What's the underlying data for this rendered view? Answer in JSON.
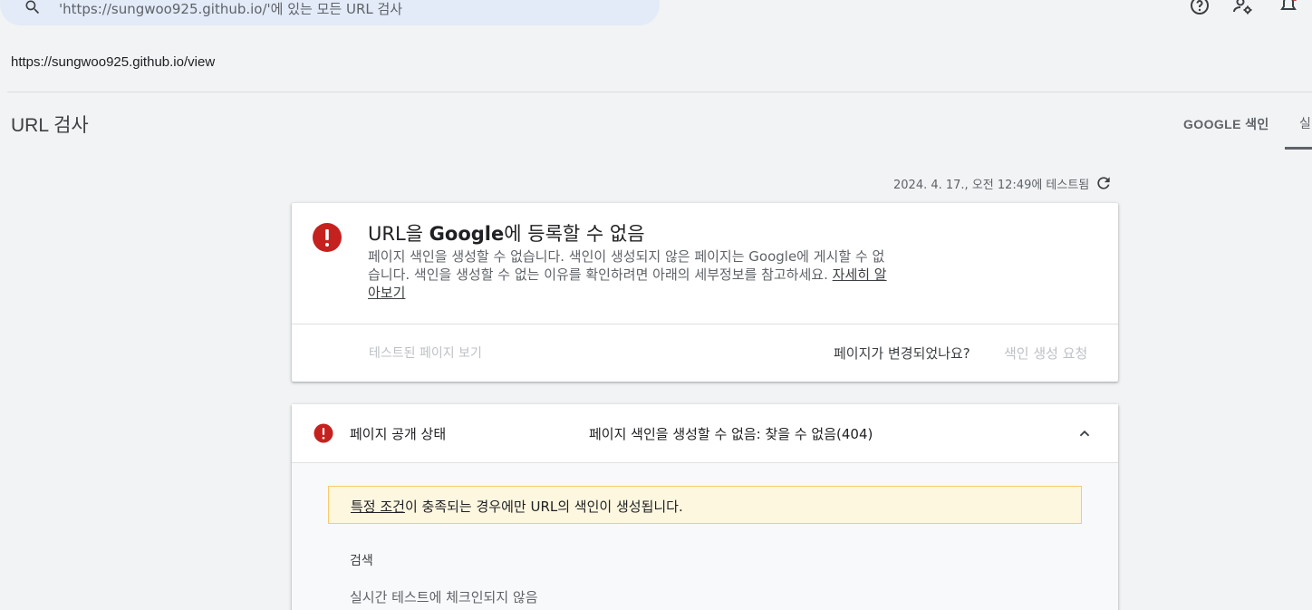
{
  "search": {
    "placeholder": "'https://sungwoo925.github.io/'에 있는 모든 URL 검사",
    "icon": "search-icon"
  },
  "topbar": {
    "icons": [
      "help-icon",
      "admin-settings-icon",
      "notifications-icon"
    ],
    "badge_color": "#d93025"
  },
  "url": "https://sungwoo925.github.io/view",
  "page_title": "URL 검사",
  "tabs": [
    {
      "label": "GOOGLE 색인"
    },
    {
      "label": "실"
    }
  ],
  "tested_at": "2024. 4. 17., 오전 12:49에 테스트됨",
  "result_card": {
    "headline_pre": "URL을 ",
    "headline_brand": "Google",
    "headline_post": "에 등록할 수 없음",
    "description": "페이지 색인을 생성할 수 없습니다. 색인이 생성되지 않은 페이지는 Google에 게시할 수 없습니다. 색인을 생성할 수 없는 이유를 확인하려면 아래의 세부정보를 참고하세요.",
    "learn_more": "자세히 알아보기",
    "view_tested_page": "테스트된 페이지 보기",
    "page_changed_question": "페이지가 변경되었나요?",
    "request_indexing": "색인 생성 요청",
    "error_color": "#c5221f"
  },
  "status_card": {
    "label": "페이지 공개 상태",
    "value": "페이지 색인을 생성할 수 없음: 찾을 수 없음(404)",
    "notice_link": "특정 조건",
    "notice_text": "이 충족되는 경우에만 URL의 색인이 생성됩니다.",
    "section_label": "검색",
    "live_check": "실시간 테스트에 체크인되지 않음"
  }
}
